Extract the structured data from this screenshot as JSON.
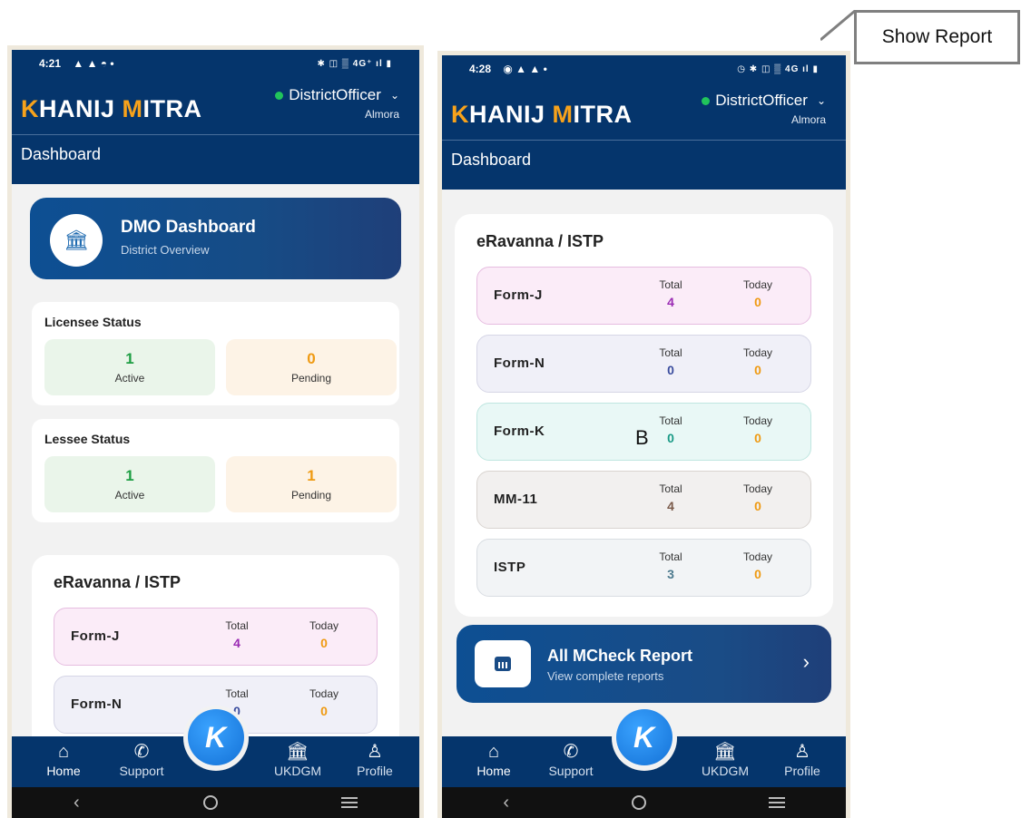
{
  "annotation": {
    "callout_text": "Show Report",
    "marker_label": "B"
  },
  "app": {
    "logo_k": "K",
    "logo_hanij": "HANIJ",
    "logo_m": "M",
    "logo_itra": "ITRA",
    "user_name": "DistrictOfficer",
    "user_location": "Almora",
    "page_title": "Dashboard"
  },
  "phone_a": {
    "status_time": "4:21",
    "status_left_icons": "▲ ▲ ◓ •",
    "status_right_icons": "✱ ◫ ▒ 4G⁺ ıl ▮",
    "dmo": {
      "title": "DMO Dashboard",
      "subtitle": "District Overview"
    },
    "licensee": {
      "title": "Licensee Status",
      "active_value": "1",
      "active_label": "Active",
      "pending_value": "0",
      "pending_label": "Pending"
    },
    "lessee": {
      "title": "Lessee Status",
      "active_value": "1",
      "active_label": "Active",
      "pending_value": "1",
      "pending_label": "Pending"
    },
    "eravanna_title": "eRavanna / ISTP",
    "forms": [
      {
        "name": "Form-J",
        "total_label": "Total",
        "total": "4",
        "today_label": "Today",
        "today": "0"
      },
      {
        "name": "Form-N",
        "total_label": "Total",
        "total": "0",
        "today_label": "Today",
        "today": "0"
      }
    ]
  },
  "phone_b": {
    "status_time": "4:28",
    "status_left_icons": "◉ ▲ ▲ •",
    "status_right_icons": "◷ ✱ ◫ ▒ 4G ıl ▮",
    "eravanna_title": "eRavanna / ISTP",
    "forms": [
      {
        "name": "Form-J",
        "total_label": "Total",
        "total": "4",
        "today_label": "Today",
        "today": "0"
      },
      {
        "name": "Form-N",
        "total_label": "Total",
        "total": "0",
        "today_label": "Today",
        "today": "0"
      },
      {
        "name": "Form-K",
        "total_label": "Total",
        "total": "0",
        "today_label": "Today",
        "today": "0"
      },
      {
        "name": "MM-11",
        "total_label": "Total",
        "total": "4",
        "today_label": "Today",
        "today": "0"
      },
      {
        "name": "ISTP",
        "total_label": "Total",
        "total": "3",
        "today_label": "Today",
        "today": "0"
      }
    ],
    "mcheck": {
      "title": "All MCheck Report",
      "subtitle": "View complete reports",
      "arrow": "›"
    }
  },
  "nav": {
    "fab_letter": "K",
    "items": [
      {
        "label": "Home",
        "icon": "home-icon"
      },
      {
        "label": "Support",
        "icon": "phone-icon"
      },
      {
        "label": "UKDGM",
        "icon": "building-icon"
      },
      {
        "label": "Profile",
        "icon": "profile-icon"
      }
    ]
  },
  "colors": {
    "header_blue": "#05356c",
    "accent_orange": "#f7a21b",
    "active_green": "#1e9e43",
    "pending_orange": "#ef9a12",
    "fab_blue": "#1471d6"
  }
}
